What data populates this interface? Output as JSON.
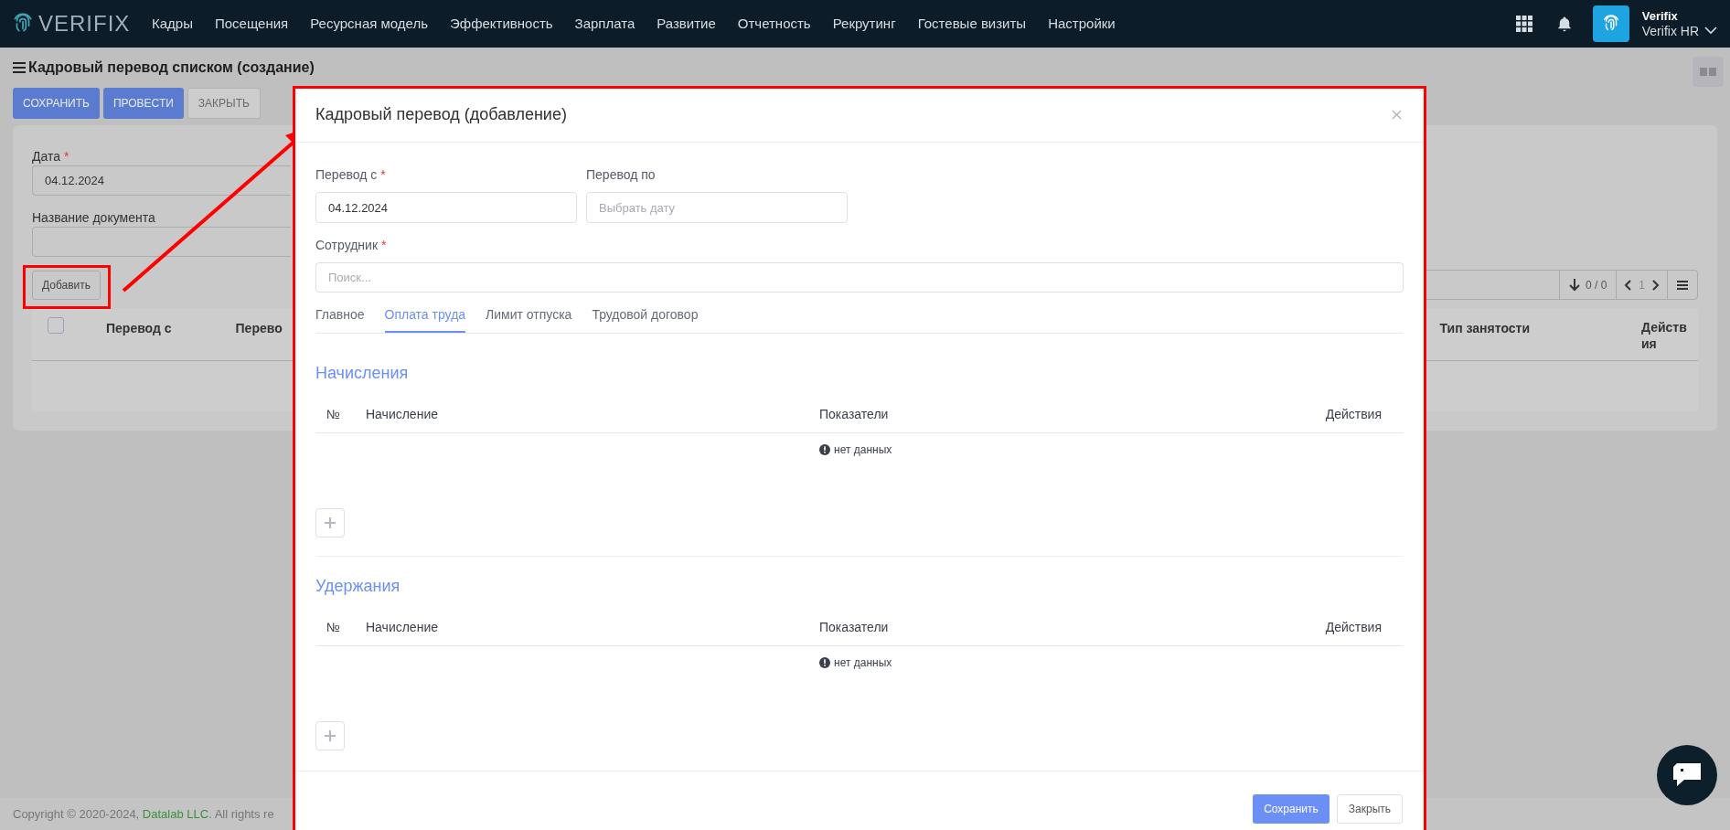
{
  "nav": {
    "logo": "VERIFIX",
    "items": [
      "Кадры",
      "Посещения",
      "Ресурсная модель",
      "Эффективность",
      "Зарплата",
      "Развитие",
      "Отчетность",
      "Рекрутинг",
      "Гостевые визиты",
      "Настройки"
    ],
    "user": {
      "name": "Verifix",
      "org": "Verifix HR"
    }
  },
  "page": {
    "title": "Кадровый перевод списком (создание)",
    "actions": [
      {
        "label": "СОХРАНИТЬ",
        "kind": "primary"
      },
      {
        "label": "ПРОВЕСТИ",
        "kind": "primary"
      },
      {
        "label": "ЗАКРЫТЬ",
        "kind": "default"
      }
    ],
    "fields": [
      {
        "label": "Дата",
        "required": true,
        "value": "04.12.2024"
      },
      {
        "label": "Название документа",
        "required": false
      }
    ],
    "add_button": "Добавить",
    "pager": {
      "count": "0 / 0",
      "page": "1"
    },
    "table": {
      "checked": false,
      "columns": [
        "Перевод с",
        "Перево",
        "Тип занятости",
        "Действия"
      ]
    }
  },
  "modal": {
    "title": "Кадровый перевод (добавление)",
    "fields": [
      {
        "label": "Перевод с",
        "required": true,
        "value": "04.12.2024"
      },
      {
        "label": "Перевод по",
        "required": false,
        "placeholder": "Выбрать дату"
      },
      {
        "label": "Сотрудник",
        "required": true,
        "placeholder": "Поиск..."
      }
    ],
    "tabs": [
      {
        "label": "Главное",
        "selected": false
      },
      {
        "label": "Оплата труда",
        "selected": true
      },
      {
        "label": "Лимит отпуска",
        "selected": false
      },
      {
        "label": "Трудовой договор",
        "selected": false
      }
    ],
    "sections": [
      {
        "title": "Начисления",
        "columns": [
          "№",
          "Начисление",
          "Показатели",
          "Действия"
        ],
        "empty": "нет данных"
      },
      {
        "title": "Удержания",
        "columns": [
          "№",
          "Начисление",
          "Показатели",
          "Действия"
        ],
        "empty": "нет данных"
      }
    ],
    "buttons": [
      {
        "label": "Сохранить",
        "kind": "primary"
      },
      {
        "label": "Закрыть",
        "kind": "default"
      }
    ]
  },
  "required_mark": "*",
  "footer": {
    "text": "Copyright © 2020-2024,",
    "link": "Datalab LLC",
    "rest": ". All rights re"
  }
}
